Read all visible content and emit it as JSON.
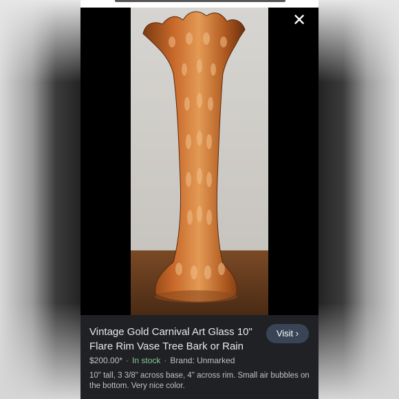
{
  "viewer": {
    "close_icon": "close-icon",
    "image_alt": "Orange iridescent carnival glass vase with flared ruffled rim"
  },
  "listing": {
    "title_line1": "Vintage Gold Carnival Art Glass 10\"",
    "title_line2": "Flare Rim Vase Tree Bark or Rain",
    "visit_label": "Visit",
    "price": "$200.00*",
    "stock": "In stock",
    "brand": "Brand: Unmarked",
    "description_line1": "10\" tall, 3 3/8\" across base, 4\" across rim. Small air bubbles on",
    "description_line2": "the bottom. Very nice color."
  },
  "colors": {
    "panel_bg": "#202124",
    "stock_green": "#81c995",
    "visit_bg": "#394457"
  }
}
